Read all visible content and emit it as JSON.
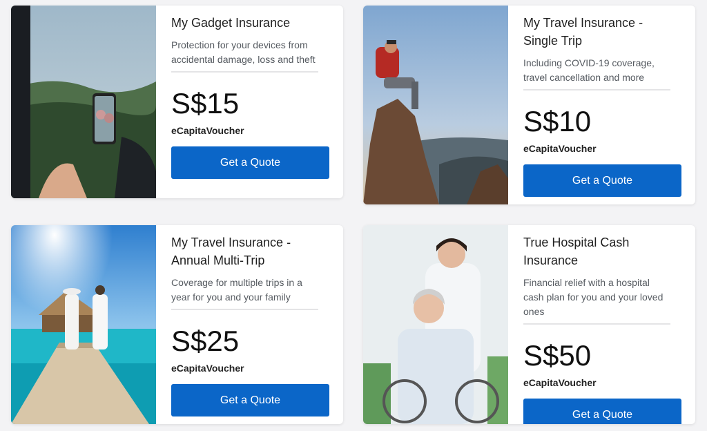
{
  "cards": [
    {
      "title_lines": [
        "My Gadget Insurance",
        ""
      ],
      "description": "Protection for your devices from accidental damage, loss and theft",
      "price": "S$15",
      "voucher": "eCapitaVoucher",
      "button_label": "Get a Quote"
    },
    {
      "title_lines": [
        "My Travel Insurance -",
        "Single Trip"
      ],
      "description": "Including COVID-19 coverage, travel cancellation and more",
      "price": "S$10",
      "voucher": "eCapitaVoucher",
      "button_label": "Get a Quote"
    },
    {
      "title_lines": [
        "My Travel Insurance -",
        "Annual Multi-Trip"
      ],
      "description": "Coverage for multiple trips in a year for you and your family",
      "price": "S$25",
      "voucher": "eCapitaVoucher",
      "button_label": "Get a Quote"
    },
    {
      "title_lines": [
        "True Hospital Cash",
        "Insurance"
      ],
      "description": "Financial relief with a hospital cash plan for you and your loved ones",
      "price": "S$50",
      "voucher": "eCapitaVoucher",
      "button_label": "Get a Quote"
    }
  ],
  "colors": {
    "button": "#0b66c8",
    "background": "#f3f3f5"
  }
}
